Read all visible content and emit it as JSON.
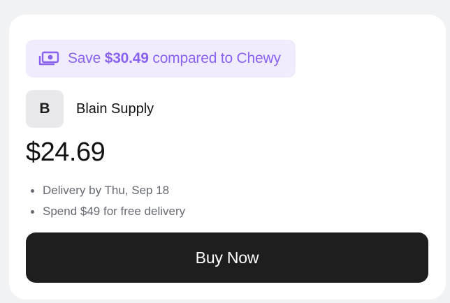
{
  "savings": {
    "prefix": "Save",
    "amount": "$30.49",
    "suffix": "compared to Chewy",
    "icon": "money-icon",
    "color": "#8a62f0",
    "background": "#f1ecfd"
  },
  "seller": {
    "initial": "B",
    "name": "Blain Supply"
  },
  "price": "$24.69",
  "details": [
    "Delivery by Thu, Sep 18",
    "Spend $49 for free delivery"
  ],
  "buy_button": {
    "label": "Buy Now",
    "color": "#1e1e1e"
  }
}
